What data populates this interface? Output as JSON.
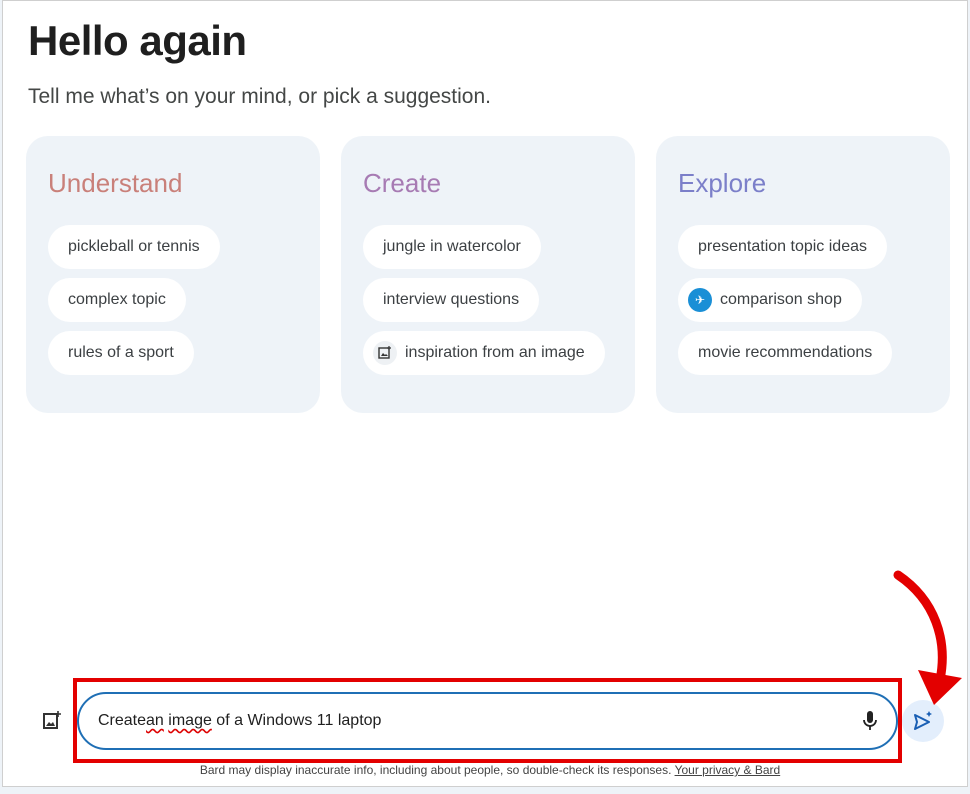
{
  "title": "Hello again",
  "subtitle": "Tell me what’s on your mind, or pick a suggestion.",
  "cards": [
    {
      "heading": "Understand",
      "color": "#c9807a",
      "chips": [
        "pickleball or tennis",
        "complex topic",
        "rules of a sport"
      ]
    },
    {
      "heading": "Create",
      "color": "#a77bb3",
      "chips": [
        "jungle in watercolor",
        "interview questions",
        "inspiration from an image"
      ]
    },
    {
      "heading": "Explore",
      "color": "#7b7fc9",
      "chips": [
        "presentation topic ideas",
        "comparison shop",
        "movie recommendations"
      ]
    }
  ],
  "chip_icons": {
    "inspiration from an image": "image-add-icon",
    "comparison shop": "airplane-icon"
  },
  "prompt": {
    "value_parts": [
      "Create ",
      "an",
      " ",
      "image",
      " of a Windows 11 laptop"
    ]
  },
  "footer": {
    "text": "Bard may display inaccurate info, including about people, so double-check its responses.",
    "link": "Your privacy & Bard"
  },
  "colors": {
    "annotation": "#e30000",
    "input_border": "#1f6fb5"
  }
}
